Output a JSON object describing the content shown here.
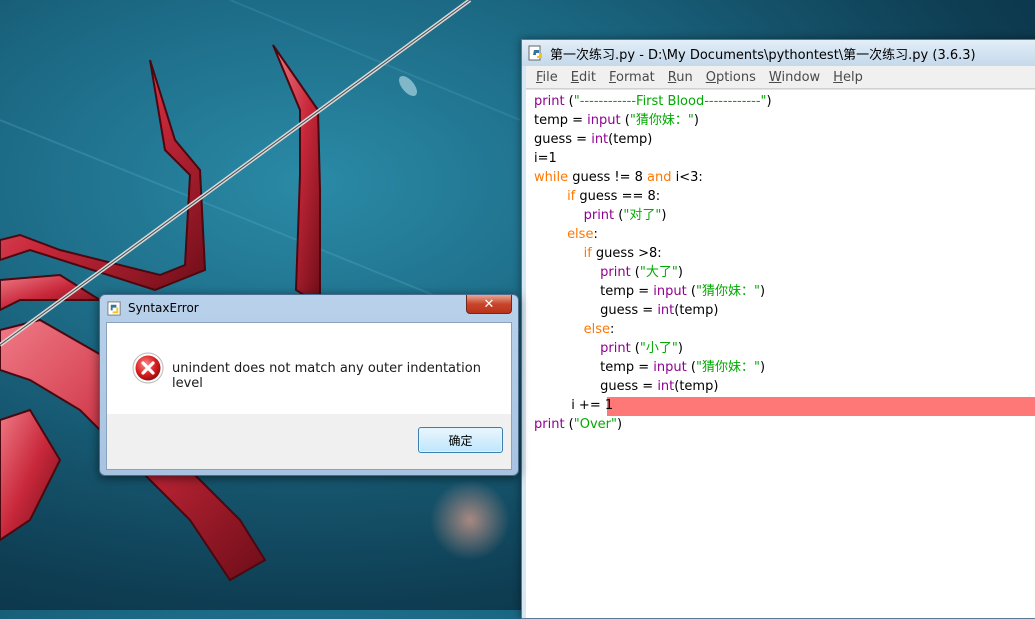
{
  "desktop": {
    "wallpaper": "spider-man-themed wallpaper"
  },
  "idle": {
    "title": "第一次练习.py - D:\\My Documents\\pythontest\\第一次练习.py (3.6.3)",
    "menu": [
      {
        "label": "File",
        "mnemonic": "F",
        "rest": "ile"
      },
      {
        "label": "Edit",
        "mnemonic": "E",
        "rest": "dit"
      },
      {
        "label": "Format",
        "mnemonic": "F",
        "rest": "ormat",
        "pre": ""
      },
      {
        "label": "Run",
        "mnemonic": "R",
        "rest": "un"
      },
      {
        "label": "Options",
        "mnemonic": "O",
        "rest": "ptions"
      },
      {
        "label": "Window",
        "mnemonic": "W",
        "rest": "indow"
      },
      {
        "label": "Help",
        "mnemonic": "H",
        "rest": "elp"
      }
    ],
    "code": [
      [
        [
          "bi",
          "print"
        ],
        [
          "plain",
          " ("
        ],
        [
          "str",
          "\"------------First Blood------------\""
        ],
        [
          "plain",
          ")"
        ]
      ],
      [
        [
          "plain",
          "temp = "
        ],
        [
          "bi",
          "input"
        ],
        [
          "plain",
          " ("
        ],
        [
          "str",
          "\"猜你妹：\""
        ],
        [
          "plain",
          ")"
        ]
      ],
      [
        [
          "plain",
          "guess = "
        ],
        [
          "bi",
          "int"
        ],
        [
          "plain",
          "(temp)"
        ]
      ],
      [
        [
          "plain",
          "i=1"
        ]
      ],
      [
        [
          "kw",
          "while"
        ],
        [
          "plain",
          " guess != 8 "
        ],
        [
          "kw",
          "and"
        ],
        [
          "plain",
          " i<3:"
        ]
      ],
      [
        [
          "plain",
          "        "
        ],
        [
          "kw",
          "if"
        ],
        [
          "plain",
          " guess == 8:"
        ]
      ],
      [
        [
          "plain",
          "            "
        ],
        [
          "bi",
          "print"
        ],
        [
          "plain",
          " ("
        ],
        [
          "str",
          "\"对了\""
        ],
        [
          "plain",
          ")"
        ]
      ],
      [
        [
          "plain",
          "        "
        ],
        [
          "kw",
          "else"
        ],
        [
          "plain",
          ":"
        ]
      ],
      [
        [
          "plain",
          "            "
        ],
        [
          "kw",
          "if"
        ],
        [
          "plain",
          " guess >8:"
        ]
      ],
      [
        [
          "plain",
          "                "
        ],
        [
          "bi",
          "print"
        ],
        [
          "plain",
          " ("
        ],
        [
          "str",
          "\"大了\""
        ],
        [
          "plain",
          ")"
        ]
      ],
      [
        [
          "plain",
          "                temp = "
        ],
        [
          "bi",
          "input"
        ],
        [
          "plain",
          " ("
        ],
        [
          "str",
          "\"猜你妹：\""
        ],
        [
          "plain",
          ")"
        ]
      ],
      [
        [
          "plain",
          "                guess = "
        ],
        [
          "bi",
          "int"
        ],
        [
          "plain",
          "(temp)"
        ]
      ],
      [
        [
          "plain",
          "            "
        ],
        [
          "kw",
          "else"
        ],
        [
          "plain",
          ":"
        ]
      ],
      [
        [
          "plain",
          "                "
        ],
        [
          "bi",
          "print"
        ],
        [
          "plain",
          " ("
        ],
        [
          "str",
          "\"小了\""
        ],
        [
          "plain",
          ")"
        ]
      ],
      [
        [
          "plain",
          "                temp = "
        ],
        [
          "bi",
          "input"
        ],
        [
          "plain",
          " ("
        ],
        [
          "str",
          "\"猜你妹：\""
        ],
        [
          "plain",
          ")"
        ]
      ],
      [
        [
          "plain",
          "                guess = "
        ],
        [
          "bi",
          "int"
        ],
        [
          "plain",
          "(temp)"
        ]
      ],
      [
        [
          "plain",
          "         i += 1"
        ]
      ],
      [
        [
          "bi",
          "print"
        ],
        [
          "plain",
          " ("
        ],
        [
          "str",
          "\"Over\""
        ],
        [
          "plain",
          ")"
        ]
      ]
    ],
    "error_line_index": 16
  },
  "dialog": {
    "title": "SyntaxError",
    "close_label": "✕",
    "message": "unindent does not match any outer indentation level",
    "ok_label": "确定"
  },
  "colors": {
    "keyword": "#ff7700",
    "builtin": "#900090",
    "string": "#00aa00",
    "error_highlight": "#ff7878"
  }
}
